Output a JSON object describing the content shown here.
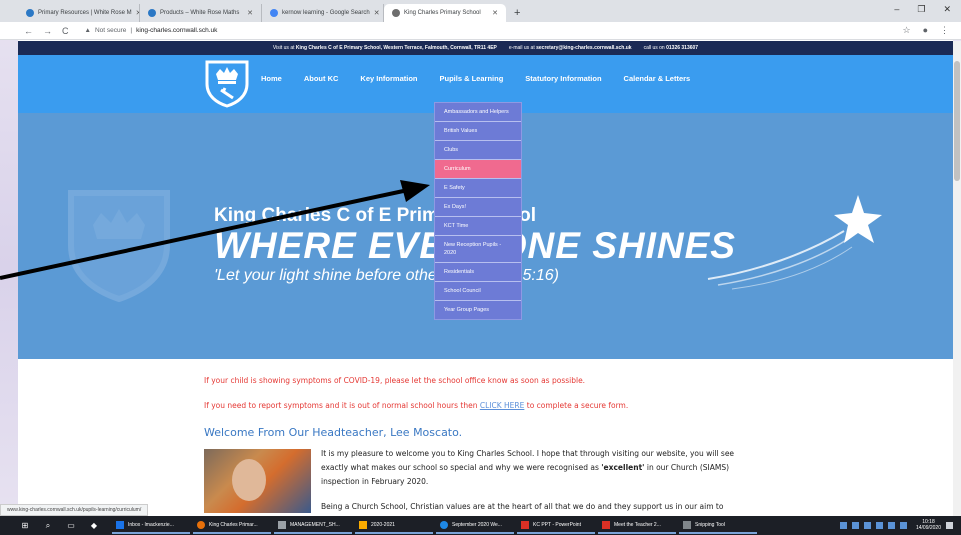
{
  "browser": {
    "tabs": [
      {
        "label": "Primary Resources | White Rose M",
        "active": false
      },
      {
        "label": "Products – White Rose Maths",
        "active": false
      },
      {
        "label": "kernow learning - Google Search",
        "active": false
      },
      {
        "label": "King Charles Primary School",
        "active": true
      }
    ],
    "new_tab": "+",
    "window_controls": [
      "–",
      "❐",
      "✕"
    ],
    "nav_buttons": [
      "←",
      "→",
      "C"
    ],
    "security_label": "Not secure",
    "url": "king-charles.cornwall.sch.uk",
    "status_url": "www.king-charles.cornwall.sch.uk/pupils-learning/curriculum/"
  },
  "site": {
    "infobar": {
      "visit_prefix": "Visit us at",
      "visit_bold": "King Charles C of E Primary School, Western Terrace, Falmouth, Cornwall, TR11 4EP",
      "email_prefix": "e-mail us at",
      "email_bold": "secretary@king-charles.cornwall.sch.uk",
      "call_prefix": "call us on",
      "call_bold": "01326 313607"
    },
    "menu": [
      "Home",
      "About KC",
      "Key Information",
      "Pupils & Learning",
      "Statutory Information",
      "Calendar & Letters"
    ],
    "dropdown": [
      {
        "label": "Ambassadors and Helpers",
        "highlight": false
      },
      {
        "label": "British Values",
        "highlight": false
      },
      {
        "label": "Clubs",
        "highlight": false
      },
      {
        "label": "Curriculum",
        "highlight": true
      },
      {
        "label": "E Safety",
        "highlight": false
      },
      {
        "label": "Ex Days!",
        "highlight": false
      },
      {
        "label": "KCT Time",
        "highlight": false
      },
      {
        "label": "New Reception Pupils - 2020",
        "highlight": false
      },
      {
        "label": "Residentials",
        "highlight": false
      },
      {
        "label": "School Council",
        "highlight": false
      },
      {
        "label": "Year Group Pages",
        "highlight": false
      }
    ],
    "hero": {
      "title": "King Charles C of E Primary School",
      "tagline": "WHERE EVERYONE SHINES",
      "quote": "'Let your light shine before others' Matthew 5:16)"
    },
    "notices": {
      "covid_1": "If your child is showing symptoms of COVID-19, please let the school office know as soon as possible.",
      "covid_2_pre": "If you need to report symptoms and it is out of normal school hours then",
      "covid_2_link": "CLICK HERE",
      "covid_2_post": "to complete a secure form."
    },
    "welcome_heading": "Welcome From Our Headteacher, Lee Moscato.",
    "paragraph_1_pre": "It is my pleasure to welcome you to King Charles School. I hope that through visiting our website, you will see exactly what makes our school so special and why we were recognised as",
    "paragraph_1_bold": "'excellent'",
    "paragraph_1_post": "in our Church (SIAMS) inspection in February 2020.",
    "paragraph_2": "Being a Church School, Christian values are at the heart of all that we do and they support us in our aim to"
  },
  "taskbar": {
    "apps": [
      {
        "label": "Inbox - lmackenzie...",
        "color": "#1a73e8"
      },
      {
        "label": "King Charles Primar...",
        "color": "#e8710a"
      },
      {
        "label": "MANAGEMENT_SH...",
        "color": "#9aa0a6"
      },
      {
        "label": "2020-2021",
        "color": "#f9ab00"
      },
      {
        "label": "September 2020 We...",
        "color": "#1e88e5"
      },
      {
        "label": "KC PPT - PowerPoint",
        "color": "#d93025"
      },
      {
        "label": "Meet the Teacher 2...",
        "color": "#d93025"
      },
      {
        "label": "Snipping Tool",
        "color": "#80868b"
      }
    ],
    "time": "10:18",
    "date": "14/09/2020"
  },
  "colors": {
    "nav_blue": "#3a9cef",
    "hero_blue": "#5b9ad5",
    "dropdown_purple": "#6d7bd6",
    "dropdown_highlight": "#f06a8f",
    "infobar_navy": "#1b2a55",
    "alert_red": "#e53935"
  }
}
